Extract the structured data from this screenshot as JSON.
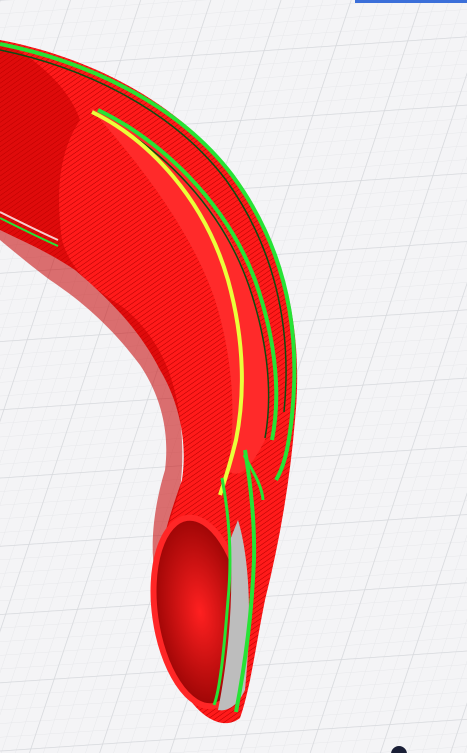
{
  "viewport": {
    "background": "#f4f4f6",
    "grid_minor_color": "#e6e7ea",
    "grid_major_color": "#d6d8dc"
  },
  "model": {
    "preview_type": "layer-view",
    "colors": {
      "outer_wall": "#ff1a1a",
      "outer_wall_dark": "#b10000",
      "inner_wall": "#27e335",
      "travel_highlight": "#eaff3a",
      "inner_surface_gray": "#bdbdbd"
    }
  },
  "icons": {
    "top_strip": "viewport-top-edge-indicator",
    "corner_control": "navigation-control-icon"
  }
}
